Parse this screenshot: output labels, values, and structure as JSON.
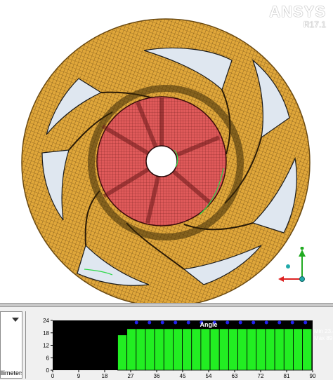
{
  "viewport": {
    "brand_name": "ANSYS",
    "brand_version": "R17.1",
    "triad_axes": [
      "Y",
      "X",
      "Z"
    ]
  },
  "panel": {
    "units_label": "illimeters",
    "dropdown_icon": "chevron-down-icon"
  },
  "colors": {
    "impeller_mesh": "#e0a73a",
    "hub_mesh": "#e05a5a",
    "histogram_bars": "#22ee22",
    "histogram_bg": "#000000",
    "triad_y": "#22aa22",
    "triad_x": "#dd2222",
    "triad_z": "#22aaaa"
  },
  "chart_data": {
    "type": "bar",
    "title": "Angle",
    "x_ticks": [
      0,
      9,
      18,
      27,
      36,
      45,
      54,
      63,
      72,
      81,
      90
    ],
    "y_ticks": [
      0,
      6,
      12,
      18,
      24
    ],
    "ylim": [
      0,
      24
    ],
    "xlim": [
      0,
      90
    ],
    "bins": [
      {
        "start": 0,
        "end": 22.5,
        "value": 0
      },
      {
        "start": 22.5,
        "end": 25.7,
        "value": 17
      },
      {
        "start": 25.7,
        "end": 28.9,
        "value": 20
      },
      {
        "start": 28.9,
        "end": 32.1,
        "value": 20
      },
      {
        "start": 32.1,
        "end": 35.3,
        "value": 20
      },
      {
        "start": 35.3,
        "end": 38.5,
        "value": 20
      },
      {
        "start": 38.5,
        "end": 41.7,
        "value": 20
      },
      {
        "start": 41.7,
        "end": 44.9,
        "value": 20
      },
      {
        "start": 44.9,
        "end": 48.1,
        "value": 20
      },
      {
        "start": 48.1,
        "end": 51.3,
        "value": 20
      },
      {
        "start": 51.3,
        "end": 54.5,
        "value": 20
      },
      {
        "start": 54.5,
        "end": 57.7,
        "value": 20
      },
      {
        "start": 57.7,
        "end": 60.9,
        "value": 20
      },
      {
        "start": 60.9,
        "end": 64.1,
        "value": 20
      },
      {
        "start": 64.1,
        "end": 67.3,
        "value": 20
      },
      {
        "start": 67.3,
        "end": 70.5,
        "value": 20
      },
      {
        "start": 70.5,
        "end": 73.7,
        "value": 20
      },
      {
        "start": 73.7,
        "end": 76.9,
        "value": 20
      },
      {
        "start": 76.9,
        "end": 80.1,
        "value": 20
      },
      {
        "start": 80.1,
        "end": 83.3,
        "value": 20
      },
      {
        "start": 83.3,
        "end": 86.5,
        "value": 20
      },
      {
        "start": 86.5,
        "end": 89.7,
        "value": 20
      }
    ],
    "markers_x": [
      29,
      33.5,
      38,
      42.5,
      47,
      51.5,
      56,
      60.5,
      65,
      69.5,
      74,
      78.5,
      83,
      87.5
    ],
    "min_label": "Min 23.49",
    "max_label": "Max 89.46"
  }
}
